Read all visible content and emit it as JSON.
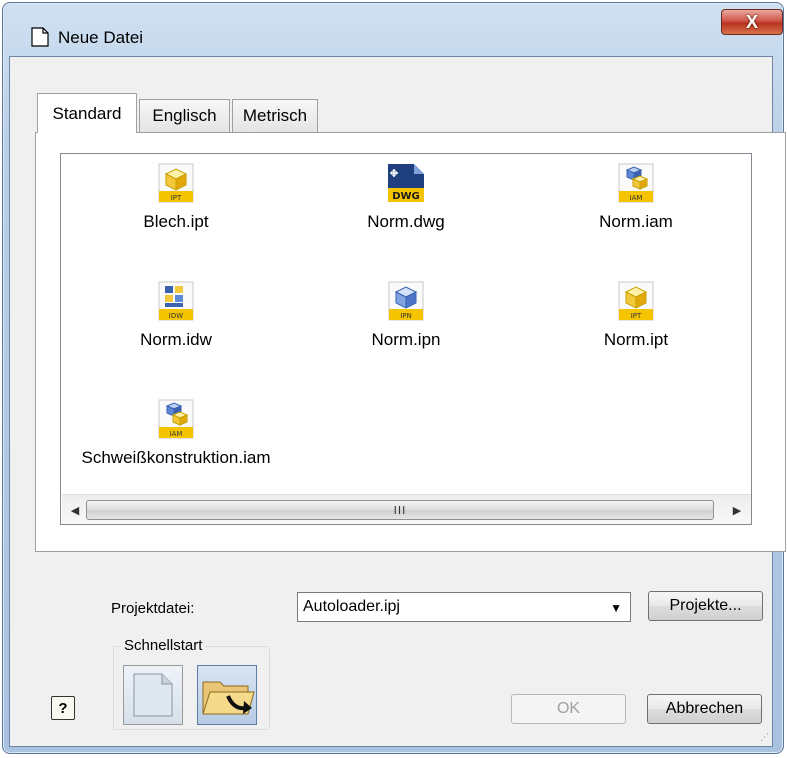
{
  "window": {
    "title": "Neue Datei",
    "close_label": "X"
  },
  "tabs": [
    {
      "label": "Standard",
      "active": true
    },
    {
      "label": "Englisch",
      "active": false
    },
    {
      "label": "Metrisch",
      "active": false
    }
  ],
  "files": [
    {
      "name": "Blech.ipt",
      "icon": "ipt-part-icon",
      "badge": "IPT"
    },
    {
      "name": "Norm.dwg",
      "icon": "dwg-drawing-icon",
      "badge": "DWG"
    },
    {
      "name": "Norm.iam",
      "icon": "iam-assembly-icon",
      "badge": "IAM"
    },
    {
      "name": "Norm.idw",
      "icon": "idw-drawing-icon",
      "badge": "IDW"
    },
    {
      "name": "Norm.ipn",
      "icon": "ipn-presentation-icon",
      "badge": "IPN"
    },
    {
      "name": "Norm.ipt",
      "icon": "ipt-part-icon",
      "badge": "IPT"
    },
    {
      "name": "Schweißkonstruktion.iam",
      "icon": "iam-assembly-icon",
      "badge": "IAM"
    }
  ],
  "scrollbar": {
    "thumb_grip": "III"
  },
  "project": {
    "label": "Projektdatei:",
    "selected": "Autoloader.ipj",
    "projects_button": "Projekte..."
  },
  "quickstart": {
    "title": "Schnellstart"
  },
  "buttons": {
    "help": "?",
    "ok": "OK",
    "cancel": "Abbrechen"
  },
  "colors": {
    "badge": "#f5c400",
    "close": "#c8402e"
  }
}
